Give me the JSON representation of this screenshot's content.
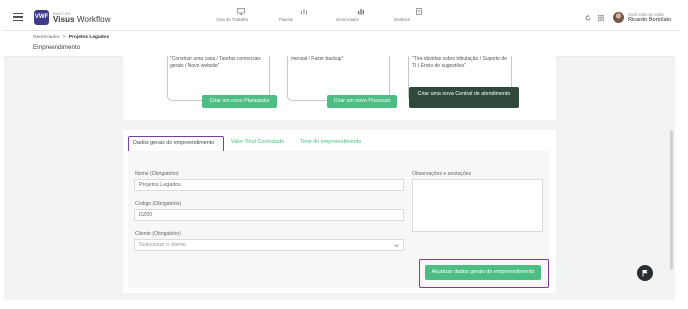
{
  "header": {
    "logo_mark": "VWF",
    "logo_small": "BUILT BY",
    "logo_name_bold": "Visus",
    "logo_name_rest": " Workflow",
    "nav": [
      {
        "label": "Área de Trabalho",
        "icon": "monitor-icon"
      },
      {
        "label": "Painéis",
        "icon": "dashboard-icon"
      },
      {
        "label": "Gerenciador",
        "icon": "bar-chart-icon"
      },
      {
        "label": "Modelos",
        "icon": "document-icon"
      }
    ],
    "user_greeting": "Você está na conta",
    "user_name": "Ricardo Bortolato"
  },
  "breadcrumb": {
    "parent": "Gerenciador",
    "separator": ">",
    "current": "Projetos Legados"
  },
  "page_title": "Empreendimento",
  "cards": [
    {
      "text": "\"Construir uma casa / Tarefas comerciais gerais / Novo website\"",
      "button": "Criar um novo Planejador"
    },
    {
      "text": "mensal / Fazer backup\"",
      "button": "Criar um novo Processo"
    },
    {
      "text": "\"Tira-dúvidas sobre tributação / Suporte de TI / Envio de sugestões\"",
      "button": "Criar uma nova Central de atendimento"
    }
  ],
  "tabs": [
    {
      "label": "Dados gerais do empreendimento",
      "active": true
    },
    {
      "label": "Valor Total Contratado",
      "active": false
    },
    {
      "label": "Time do empreendimento",
      "active": false
    }
  ],
  "form": {
    "name_label": "Nome (Obrigatório)",
    "name_value": "Projetos Legados",
    "code_label": "Codigo (Obrigatório)",
    "code_value": "DZ00",
    "client_label": "Cliente (Obrigatório)",
    "client_placeholder": "Selecionar o cliente",
    "notes_label": "Observações e anotações",
    "save_label": "Atualizar dados gerais do empreendimento"
  },
  "colors": {
    "accent_green": "#4cbe84",
    "highlight_purple": "#7a3ba5",
    "brand_purple": "#3f3a8c",
    "dark_button": "#2f4a3d"
  }
}
